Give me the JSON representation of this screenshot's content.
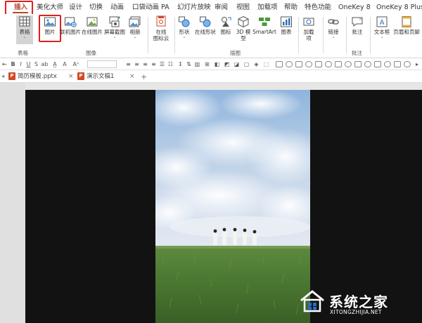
{
  "ribbon_tabs": {
    "insert": "插入",
    "beautify": "美化大师",
    "design": "设计",
    "transitions": "切换",
    "animations": "动画",
    "pocket_anim": "口袋动画 PA",
    "slideshow": "幻灯片放映",
    "review": "审阅",
    "view": "视图",
    "addins": "加载项",
    "help": "帮助",
    "special": "特色功能",
    "onekey8": "OneKey 8",
    "onekey8plus": "OneKey 8 Plus"
  },
  "ribbon": {
    "table": "表格",
    "picture": "图片",
    "pc_picture": "联机图片",
    "online_picture": "在线图片",
    "screenshot": "屏幕截图",
    "album": "相册",
    "online_icon_cloud_1": "在线",
    "online_icon_cloud_2": "图标云",
    "shapes": "形状",
    "online_shapes": "在线形状",
    "icons": "图标",
    "model3d": "3D 模",
    "model3d_2": "型",
    "smartart": "SmartArt",
    "chart": "图表",
    "addins": "加载",
    "addins_2": "项",
    "link": "链接",
    "comment": "批注",
    "textbox": "文本框",
    "header_footer": "页眉和页脚",
    "groups": {
      "tables": "表格",
      "images": "图像",
      "illustrations": "插图",
      "comments": "批注"
    }
  },
  "doc_tabs": {
    "resume_template": "简历模板.pptx",
    "presentation1": "演示文稿1"
  },
  "watermark": {
    "brand": "系统之家",
    "url": "XITONGZHIJIA.NET"
  },
  "colors": {
    "accent": "#b7472a",
    "highlight_box": "#e0201c",
    "slide_bg": "#121212"
  }
}
